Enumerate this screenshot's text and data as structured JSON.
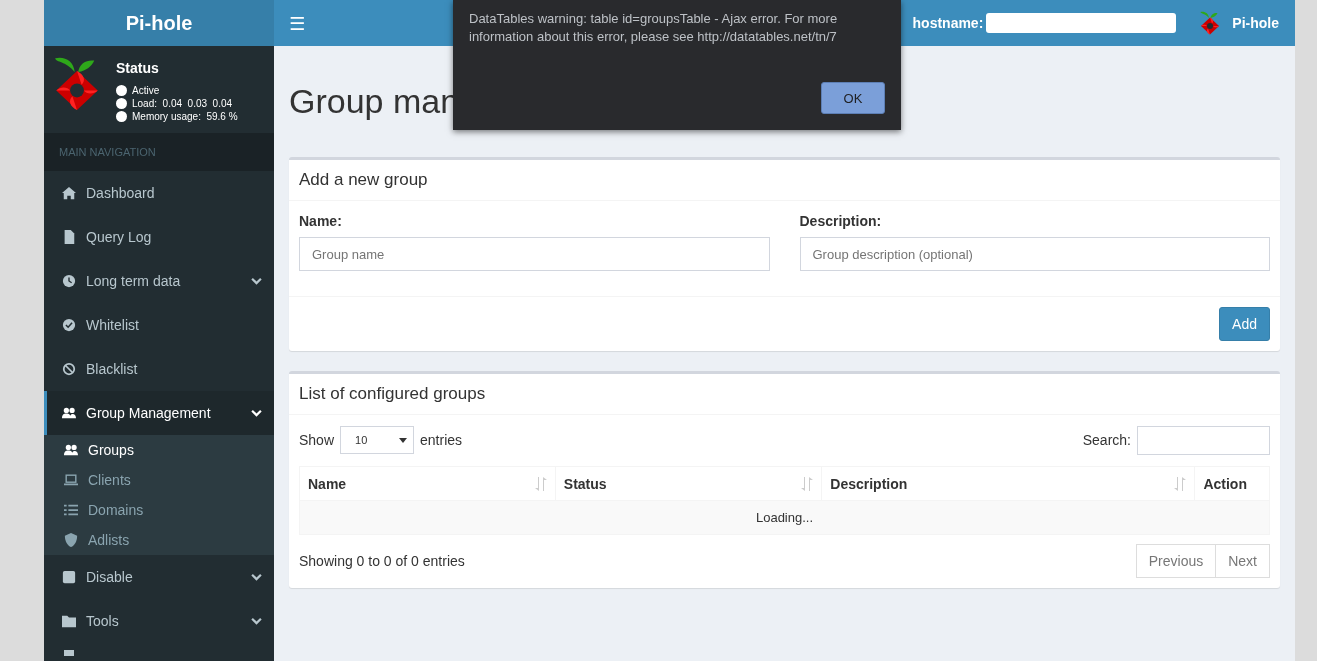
{
  "header": {
    "brand": "Pi-hole",
    "menu_toggle": "☰",
    "hostname_label": "hostname:",
    "user": "Pi-hole"
  },
  "status": {
    "title": "Status",
    "lines": [
      {
        "text": "Active"
      },
      {
        "text": "Load:  0.04  0.03  0.04"
      },
      {
        "text": "Memory usage:  59.6 %"
      }
    ]
  },
  "sidebar": {
    "section": "MAIN NAVIGATION",
    "items": [
      {
        "kind": "home",
        "label": "Dashboard",
        "expandable": false,
        "selected": false
      },
      {
        "kind": "file",
        "label": "Query Log",
        "expandable": false,
        "selected": false
      },
      {
        "kind": "clock",
        "label": "Long term data",
        "expandable": true,
        "selected": false
      },
      {
        "kind": "check",
        "label": "Whitelist",
        "expandable": false,
        "selected": false
      },
      {
        "kind": "ban",
        "label": "Blacklist",
        "expandable": false,
        "selected": false
      },
      {
        "kind": "users",
        "label": "Group Management",
        "expandable": true,
        "selected": true,
        "children": [
          {
            "kind": "users",
            "label": "Groups",
            "selected": true
          },
          {
            "kind": "laptop",
            "label": "Clients",
            "selected": false
          },
          {
            "kind": "list",
            "label": "Domains",
            "selected": false
          },
          {
            "kind": "shield",
            "label": "Adlists",
            "selected": false
          }
        ]
      },
      {
        "kind": "square",
        "label": "Disable",
        "expandable": true,
        "selected": false
      },
      {
        "kind": "folder",
        "label": "Tools",
        "expandable": true,
        "selected": false
      }
    ]
  },
  "page_title": "Group man",
  "add_group": {
    "title": "Add a new group",
    "name_label": "Name:",
    "name_placeholder": "Group name",
    "description_label": "Description:",
    "description_placeholder": "Group description (optional)",
    "button": "Add"
  },
  "groups_table": {
    "title": "List of configured groups",
    "show_label": "Show",
    "page_size": "10",
    "entries_label": "entries",
    "search_label": "Search:",
    "columns": [
      {
        "label": "Name",
        "sortable": true
      },
      {
        "label": "Status",
        "sortable": true
      },
      {
        "label": "Description",
        "sortable": true
      },
      {
        "label": "Action",
        "sortable": false
      }
    ],
    "loading": "Loading...",
    "info": "Showing 0 to 0 of 0 entries",
    "pagination": [
      "Previous",
      "Next"
    ]
  },
  "dialog": {
    "message": "DataTables warning: table id=groupsTable - Ajax error. For more information about this error, please see http://datatables.net/tn/7",
    "button": "OK"
  }
}
